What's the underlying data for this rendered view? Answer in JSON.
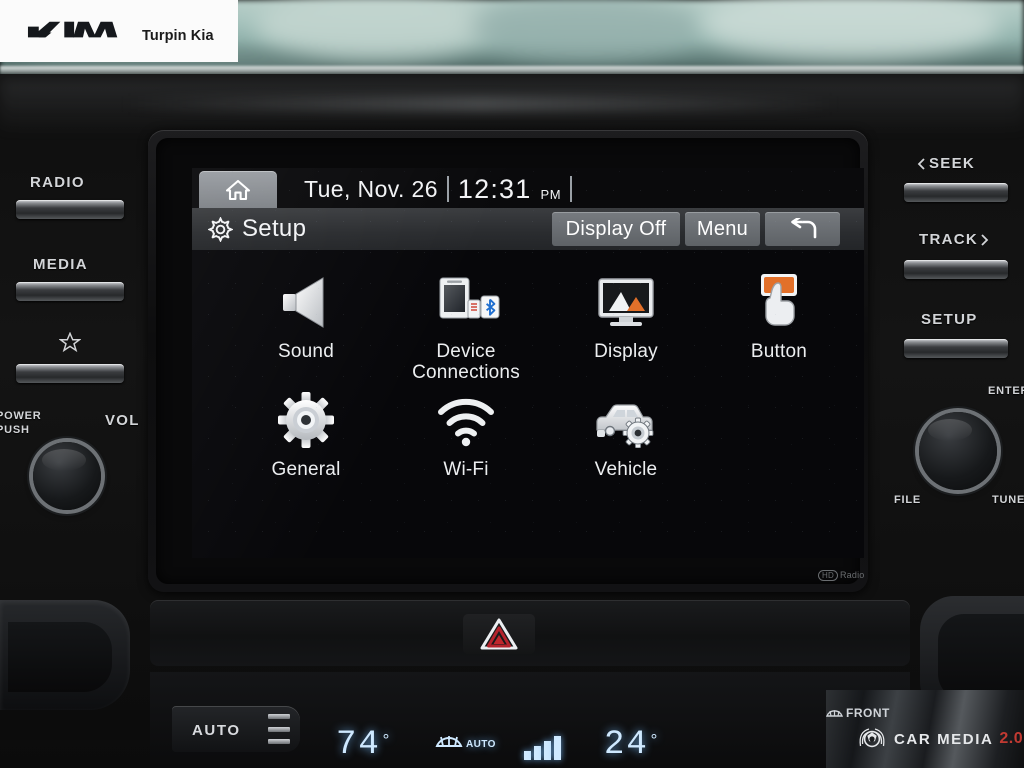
{
  "dealer": {
    "brand_logo": "kia-logo",
    "name": "Turpin Kia"
  },
  "head_unit": {
    "bezel_mark": "HD Radio",
    "hd_prefix": "HD",
    "hd_suffix": "Radio"
  },
  "screen": {
    "status_bar": {
      "home_icon": "home-icon",
      "date": "Tue, Nov. 26",
      "time": "12:31",
      "ampm": "PM"
    },
    "title_bar": {
      "gear_icon": "gear-icon",
      "title": "Setup",
      "display_off_label": "Display Off",
      "menu_label": "Menu",
      "back_icon": "back-arrow-icon"
    },
    "menu_items": [
      {
        "id": "sound",
        "label": "Sound",
        "icon": "speaker-icon"
      },
      {
        "id": "device-connections",
        "label": "Device\nConnections",
        "label_line1": "Device",
        "label_line2": "Connections",
        "icon": "phone-usb-bluetooth-icon"
      },
      {
        "id": "display",
        "label": "Display",
        "icon": "monitor-icon"
      },
      {
        "id": "button",
        "label": "Button",
        "icon": "hand-press-button-icon"
      },
      {
        "id": "general",
        "label": "General",
        "icon": "gear-icon"
      },
      {
        "id": "wifi",
        "label": "Wi-Fi",
        "icon": "wifi-icon"
      },
      {
        "id": "vehicle",
        "label": "Vehicle",
        "icon": "car-gear-icon"
      }
    ],
    "colors": {
      "background": "#07070a",
      "title_bar": "#2a2c2f",
      "button_face": "#6b6f74",
      "text": "#eceef0",
      "accent_orange": "#e2702a",
      "accent_blue": "#1f6fd0"
    }
  },
  "left_controls": {
    "radio_label": "RADIO",
    "media_label": "MEDIA",
    "favorite_icon": "star-icon",
    "power_label_line1": "POWER",
    "power_label_line2": "PUSH",
    "volume_label": "VOL",
    "knob": "volume-power-knob"
  },
  "right_controls": {
    "seek_label": "SEEK",
    "seek_arrow": "chevron-left-icon",
    "track_label": "TRACK",
    "track_arrow": "chevron-right-icon",
    "setup_label": "SETUP",
    "enter_label": "ENTER",
    "file_label": "FILE",
    "tune_label": "TUNE",
    "knob": "tune-enter-knob"
  },
  "lower_dash": {
    "hazard_icon": "hazard-triangle-icon",
    "climate": {
      "auto_label": "AUTO",
      "driver_temp": "74",
      "driver_unit": "°",
      "defog_icon": "front-defog-icon",
      "defog_auto_label": "AUTO",
      "fan_icon": "fan-level-icon",
      "passenger_temp": "24",
      "passenger_unit": "°"
    },
    "front_label": "FRONT",
    "front_icon": "rear-defog-icon"
  },
  "watermark": {
    "logo": "car-media-laurel-icon",
    "text": "CAR MEDIA",
    "version": "2.0"
  }
}
